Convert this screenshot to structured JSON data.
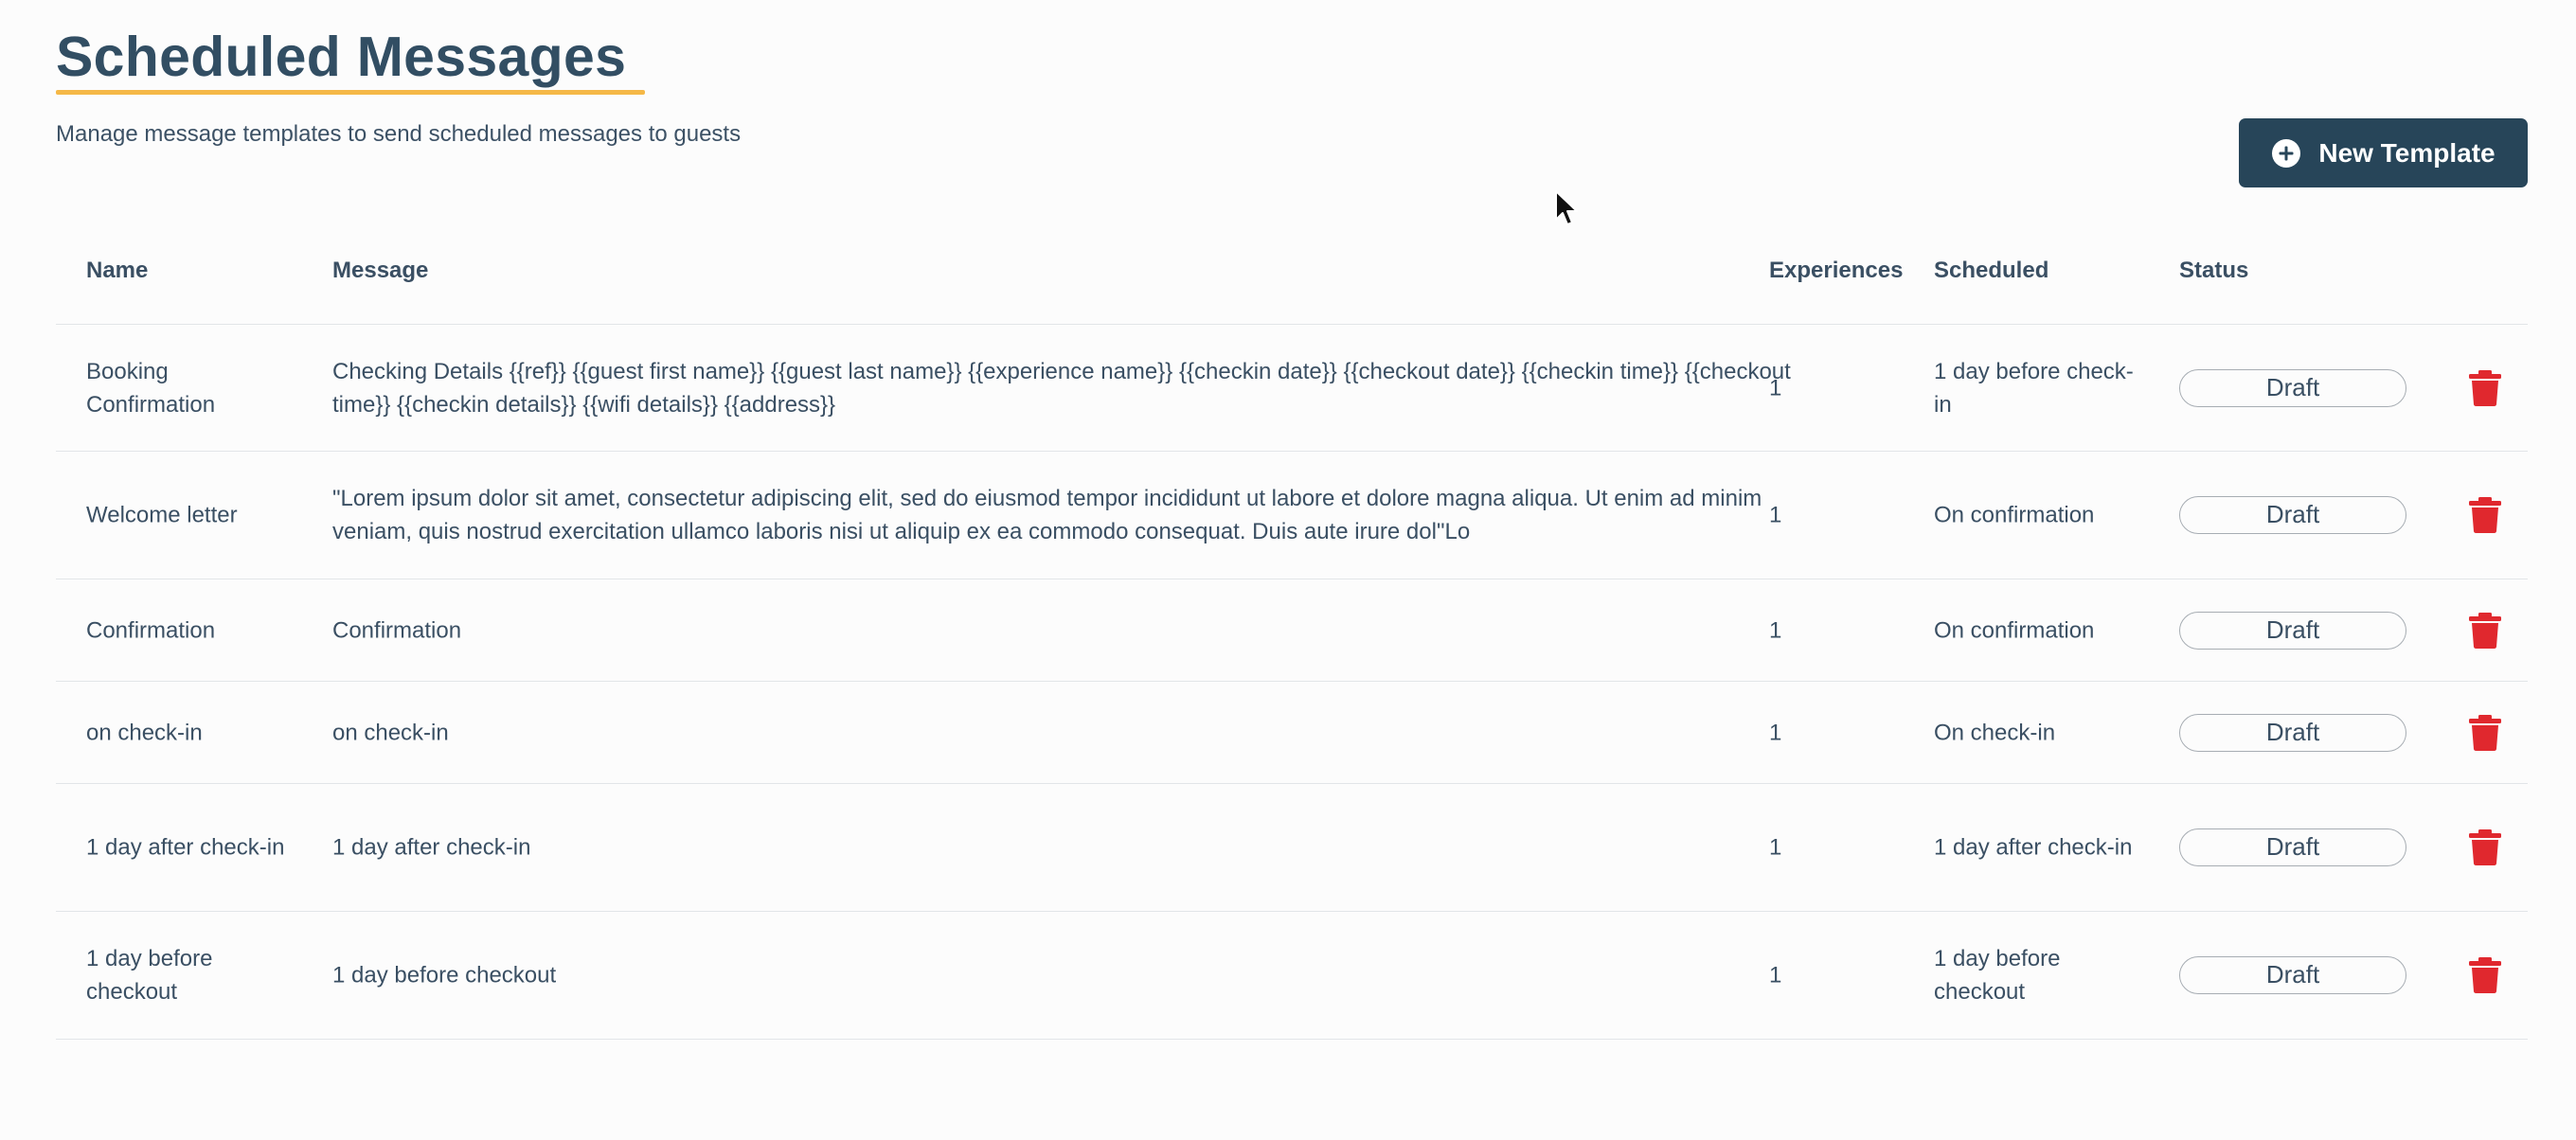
{
  "header": {
    "title": "Scheduled Messages",
    "subtitle": "Manage message templates to send scheduled messages to guests",
    "new_template_label": "New Template",
    "accent_color": "#f5b847",
    "button_color": "#274559"
  },
  "table": {
    "columns": {
      "name": "Name",
      "message": "Message",
      "experiences": "Experiences",
      "scheduled": "Scheduled",
      "status": "Status"
    },
    "rows": [
      {
        "name": "Booking Confirmation",
        "message": "Checking Details {{ref}} {{guest first name}} {{guest last name}} {{experience name}} {{checkin date}} {{checkout date}} {{checkin time}} {{checkout time}} {{checkin details}} {{wifi details}} {{address}}",
        "experiences": "1",
        "scheduled": "1 day before check-in",
        "status": "Draft"
      },
      {
        "name": "Welcome letter",
        "message": "\"Lorem ipsum dolor sit amet, consectetur adipiscing elit, sed do eiusmod tempor incididunt ut labore et dolore magna aliqua. Ut enim ad minim veniam, quis nostrud exercitation ullamco laboris nisi ut aliquip ex ea commodo consequat. Duis aute irure dol\"Lo",
        "experiences": "1",
        "scheduled": "On confirmation",
        "status": "Draft"
      },
      {
        "name": "Confirmation",
        "message": "Confirmation",
        "experiences": "1",
        "scheduled": "On confirmation",
        "status": "Draft"
      },
      {
        "name": "on check-in",
        "message": "on check-in",
        "experiences": "1",
        "scheduled": "On check-in",
        "status": "Draft"
      },
      {
        "name": "1 day after check-in",
        "message": "1 day after check-in",
        "experiences": "1",
        "scheduled": "1 day after check-in",
        "status": "Draft"
      },
      {
        "name": "1 day before checkout",
        "message": "1 day before checkout",
        "experiences": "1",
        "scheduled": "1 day before checkout",
        "status": "Draft"
      }
    ],
    "delete_icon": "trash-icon",
    "delete_color": "#e0282e"
  }
}
